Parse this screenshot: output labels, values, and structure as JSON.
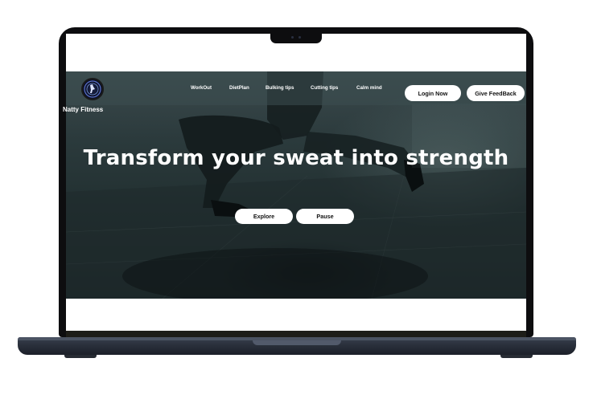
{
  "site": {
    "brand": "Natty Fitness",
    "logo_icon": "fitness-logo-icon"
  },
  "nav": {
    "items": [
      {
        "label": "WorkOut"
      },
      {
        "label": "DietPlan"
      },
      {
        "label": "Bulking tips"
      },
      {
        "label": "Cutting tips"
      },
      {
        "label": "Calm mind"
      }
    ],
    "login_label": "Login Now",
    "feedback_label": "Give FeedBack"
  },
  "hero": {
    "headline": "Transform your sweat into strength",
    "explore_label": "Explore",
    "pause_label": "Pause"
  },
  "colors": {
    "hero_tint": "#2b3a3c",
    "button_bg": "#ffffff",
    "text_light": "#ffffff",
    "bezel": "#0d0d0f",
    "base": "#2b313d"
  }
}
